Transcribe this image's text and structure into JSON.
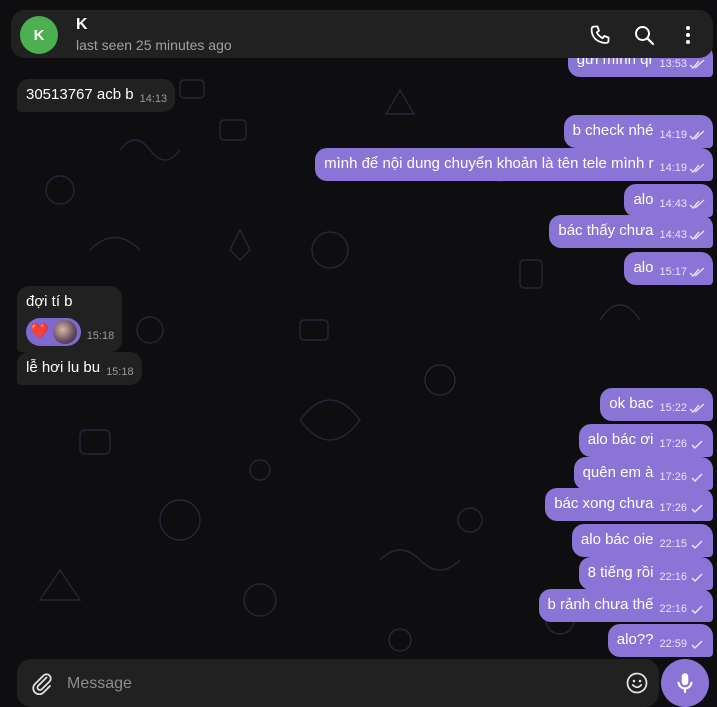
{
  "header": {
    "avatar_letter": "K",
    "name": "K",
    "status": "last seen 25 minutes ago",
    "icons": [
      "phone-icon",
      "search-icon",
      "more-vert-icon"
    ]
  },
  "messages": [
    {
      "id": "m0",
      "dir": "out",
      "text": "gửi mình qr",
      "time": "13:53",
      "ticks": "double"
    },
    {
      "id": "m1",
      "dir": "in",
      "text": "30513767 acb b",
      "time": "14:13"
    },
    {
      "id": "m2",
      "dir": "out",
      "text": "b check nhé",
      "time": "14:19",
      "ticks": "double"
    },
    {
      "id": "m3",
      "dir": "out",
      "text": "mình để nội dung chuyển khoản là tên tele mình r",
      "time": "14:19",
      "ticks": "double"
    },
    {
      "id": "m4",
      "dir": "out",
      "text": "alo",
      "time": "14:43",
      "ticks": "double"
    },
    {
      "id": "m5",
      "dir": "out",
      "text": "bác thấy chưa",
      "time": "14:43",
      "ticks": "double"
    },
    {
      "id": "m6",
      "dir": "out",
      "text": "alo",
      "time": "15:17",
      "ticks": "double"
    },
    {
      "id": "m7",
      "dir": "in",
      "text": "đợi tí b",
      "time": "15:18",
      "reaction": "❤️"
    },
    {
      "id": "m8",
      "dir": "in",
      "text": "lễ hơi lu bu",
      "time": "15:18"
    },
    {
      "id": "m9",
      "dir": "out",
      "text": "ok bac",
      "time": "15:22",
      "ticks": "double"
    },
    {
      "id": "m10",
      "dir": "out",
      "text": "alo bác ơi",
      "time": "17:26",
      "ticks": "single"
    },
    {
      "id": "m11",
      "dir": "out",
      "text": "quên em à",
      "time": "17:26",
      "ticks": "single"
    },
    {
      "id": "m12",
      "dir": "out",
      "text": "bác xong chưa",
      "time": "17:26",
      "ticks": "single"
    },
    {
      "id": "m13",
      "dir": "out",
      "text": "alo bác oie",
      "time": "22:15",
      "ticks": "single"
    },
    {
      "id": "m14",
      "dir": "out",
      "text": "8 tiếng rồi",
      "time": "22:16",
      "ticks": "single"
    },
    {
      "id": "m15",
      "dir": "out",
      "text": "b rảnh chưa thế",
      "time": "22:16",
      "ticks": "single"
    },
    {
      "id": "m16",
      "dir": "out",
      "text": "alo??",
      "time": "22:59",
      "ticks": "single"
    }
  ],
  "composer": {
    "placeholder": "Message",
    "icons": [
      "attach-icon",
      "emoji-icon",
      "microphone-icon"
    ]
  },
  "colors": {
    "background": "#0e0e10",
    "outgoing_bubble": "#8a74d6",
    "incoming_bubble": "#212121",
    "avatar": "#4caf50"
  }
}
